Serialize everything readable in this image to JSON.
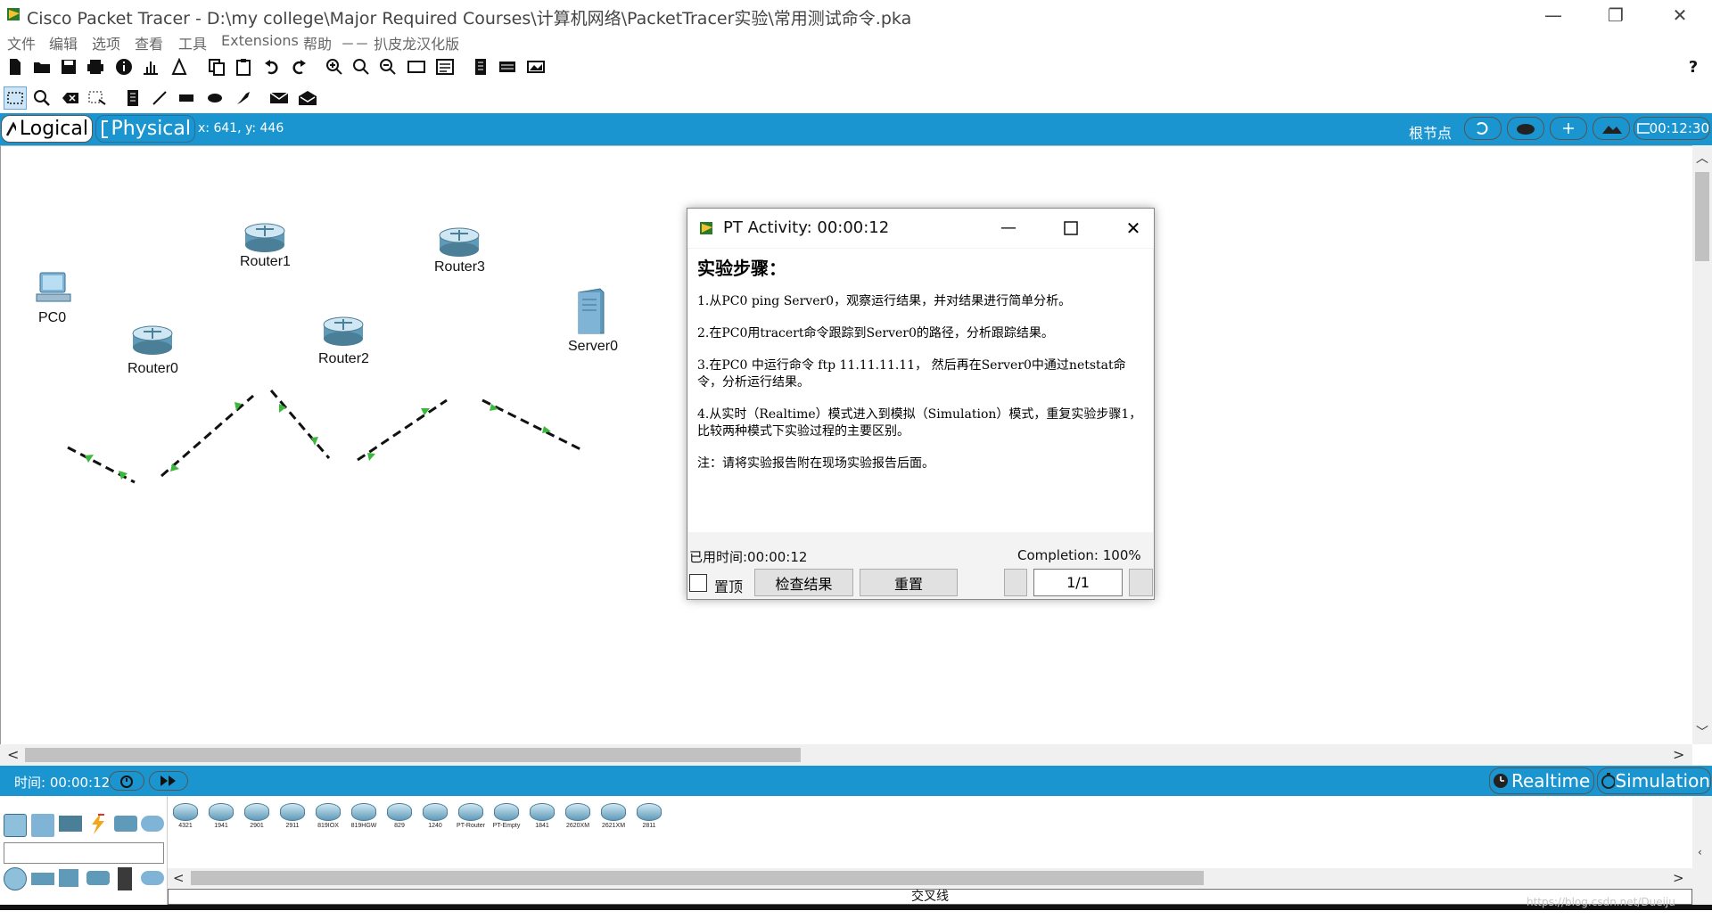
{
  "window": {
    "title": "Cisco Packet Tracer - D:\\my college\\Major Required Courses\\计算机网络\\PacketTracer实验\\常用测试命令.pka"
  },
  "menu": [
    "文件",
    "编辑",
    "选项",
    "查看",
    "工具",
    "Extensions",
    "帮助",
    "－－ 扒皮龙汉化版"
  ],
  "workspace": {
    "logical_label": "Logical",
    "physical_label": "Physical",
    "coords": "x: 641, y: 446",
    "root_label": "根节点",
    "clock": "00:12:30"
  },
  "topology": {
    "devices": [
      "PC0",
      "Router0",
      "Router1",
      "Router2",
      "Router3",
      "Server0"
    ]
  },
  "dialog": {
    "title": "PT Activity: 00:00:12",
    "heading": "实验步骤：",
    "steps": [
      "1.从PC0 ping Server0，观察运行结果，并对结果进行简单分析。",
      "2.在PC0用tracert命令跟踪到Server0的路径，分析跟踪结果。",
      "3.在PC0 中运行命令 ftp 11.11.11.11， 然后再在Server0中通过netstat命令，分析运行结果。",
      "4.从实时（Realtime）模式进入到模拟（Simulation）模式，重复实验步骤1，比较两种模式下实验过程的主要区别。",
      "注：请将实验报告附在现场实验报告后面。"
    ],
    "elapsed": "已用时间:00:00:12",
    "completion": "Completion: 100%",
    "pin_label": "置顶",
    "check_label": "检查结果",
    "reset_label": "重置",
    "page": "1/1"
  },
  "bottom": {
    "time_label": "时间: 00:00:12",
    "realtime_label": "Realtime",
    "simulation_label": "Simulation"
  },
  "device_models": [
    "4321",
    "1941",
    "2901",
    "2911",
    "819IOX",
    "819HGW",
    "829",
    "1240",
    "PT-Router",
    "PT-Empty",
    "1841",
    "2620XM",
    "2621XM",
    "2811"
  ],
  "status": {
    "cable_label": "交叉线",
    "watermark": "https://blog.csdn.net/Dueiju"
  },
  "colors": {
    "accent": "#1a95cf",
    "link_up": "#3cb83c"
  }
}
